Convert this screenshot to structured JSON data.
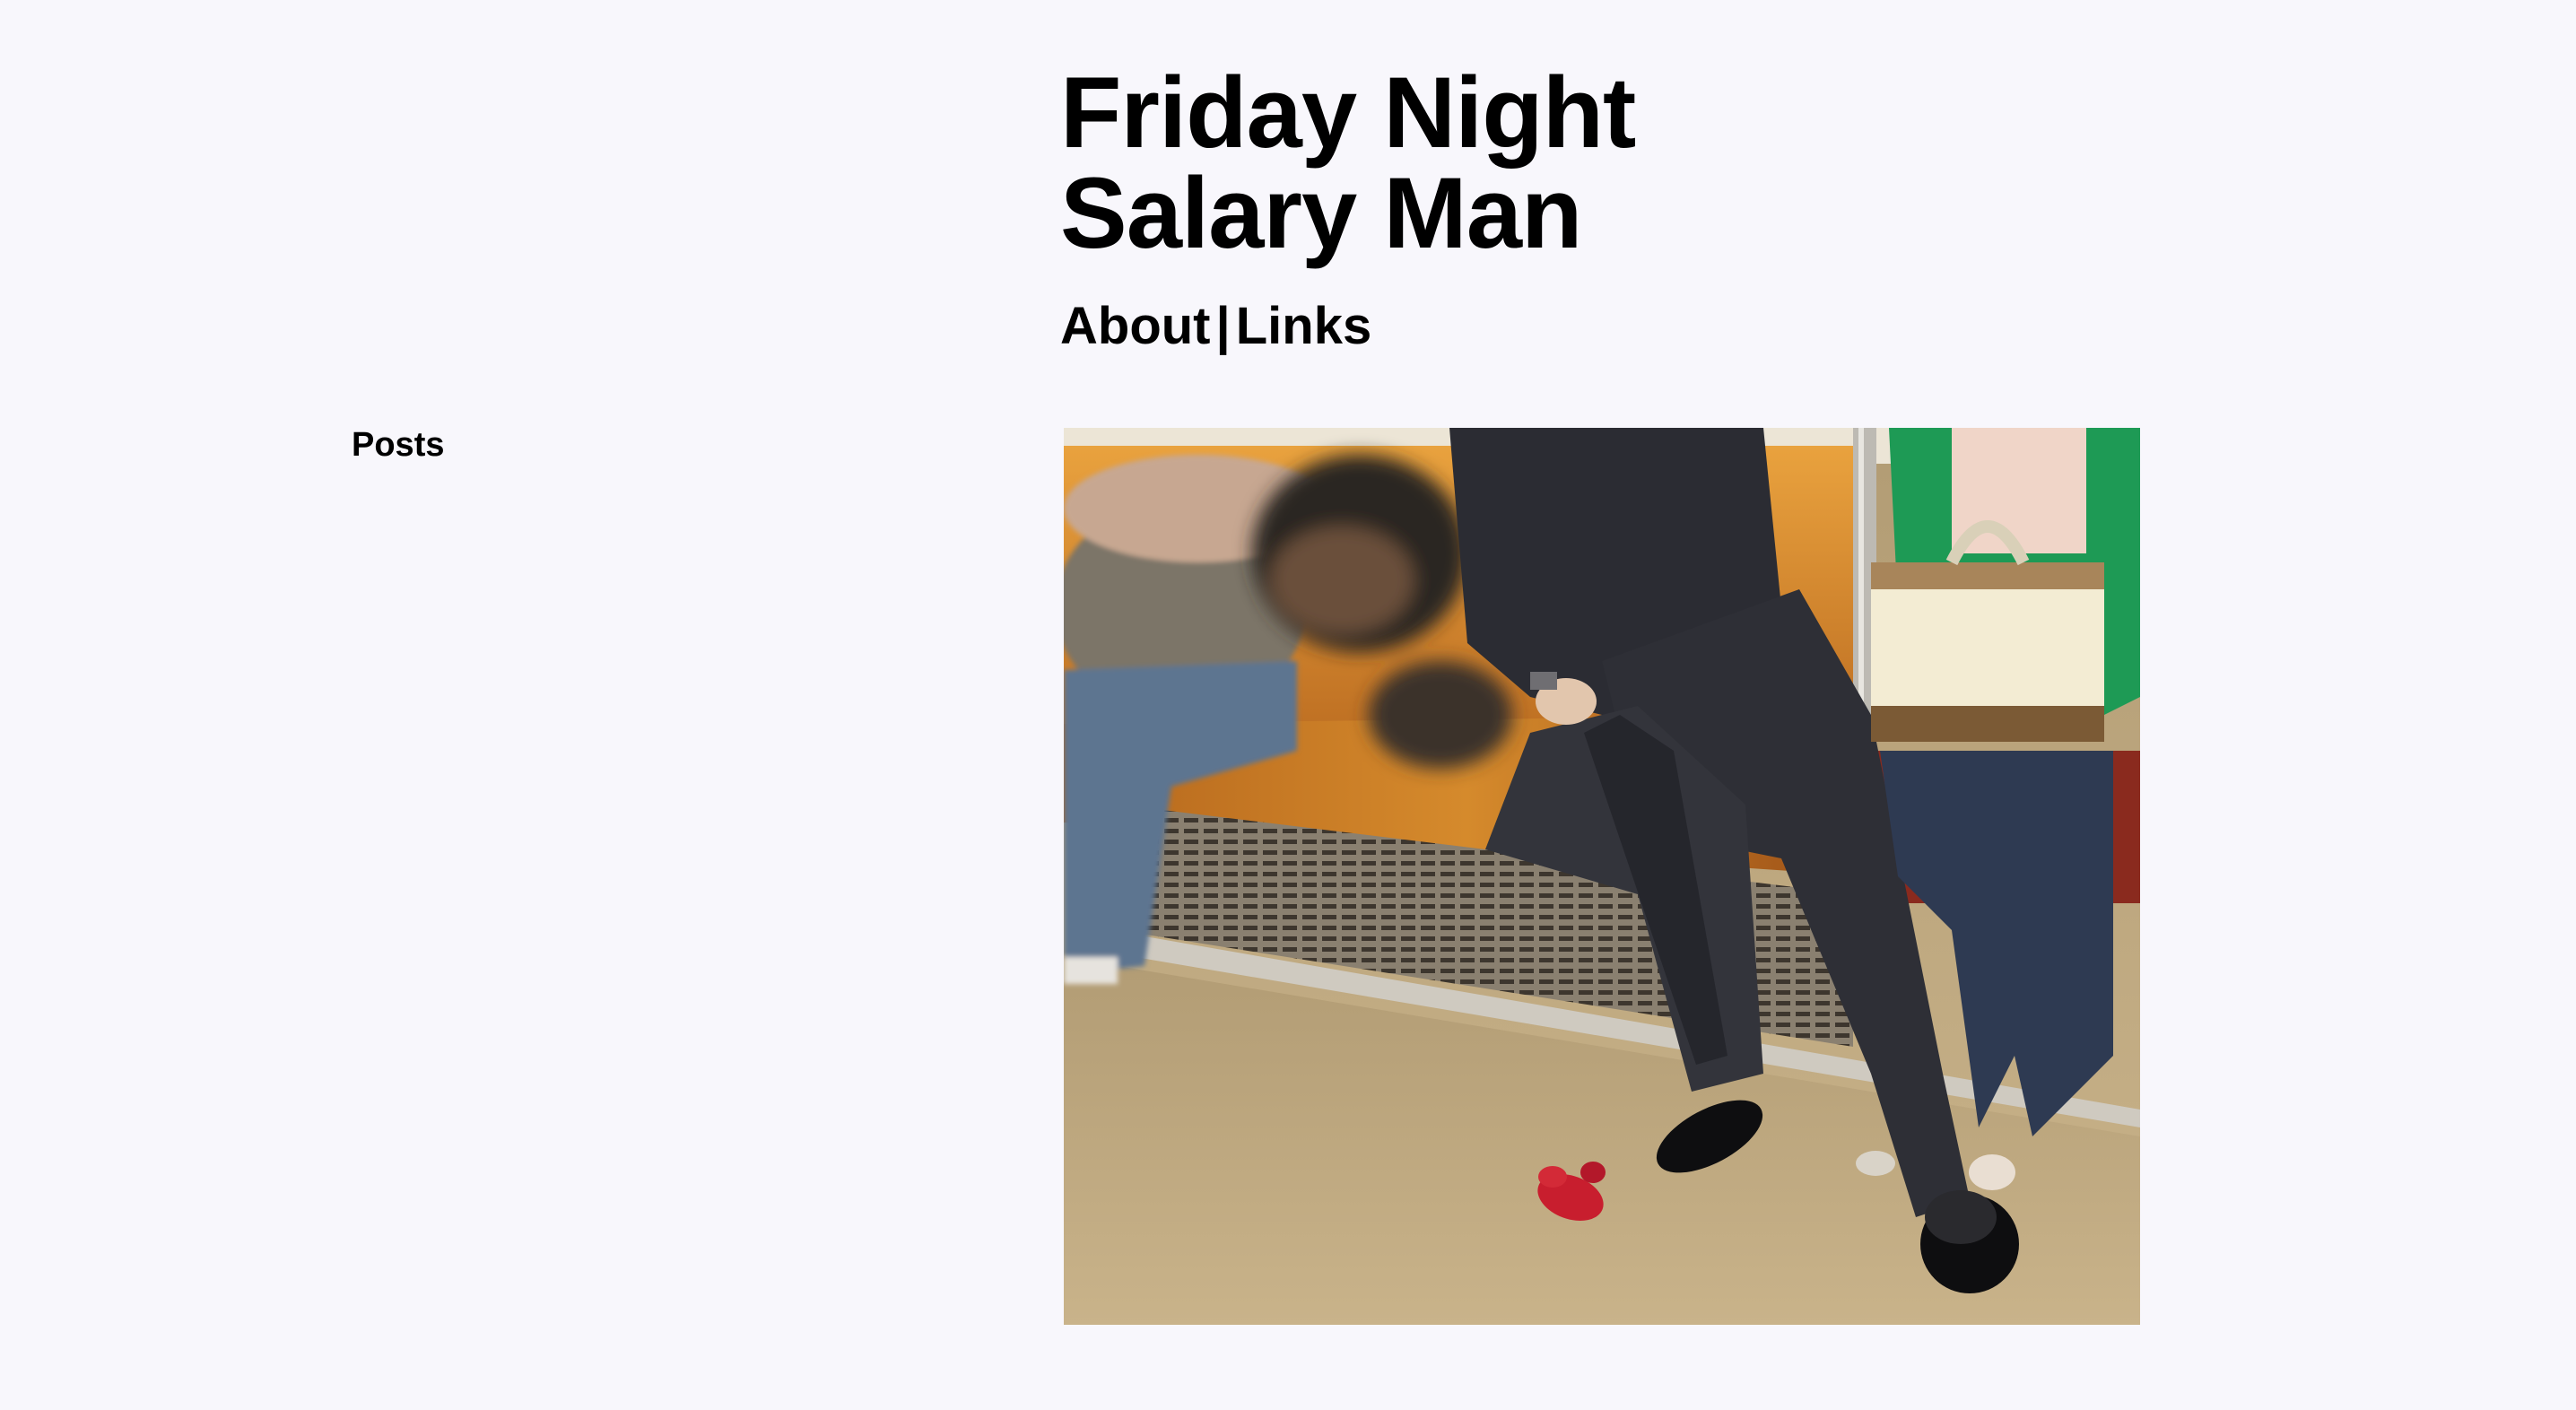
{
  "header": {
    "title_line1": "Friday Night",
    "title_line2": "Salary Man"
  },
  "nav": {
    "about": "About",
    "separator": "|",
    "links": "Links"
  },
  "sidebar": {
    "heading": "Posts"
  },
  "colors": {
    "background": "#f8f7fc",
    "text": "#000000"
  }
}
